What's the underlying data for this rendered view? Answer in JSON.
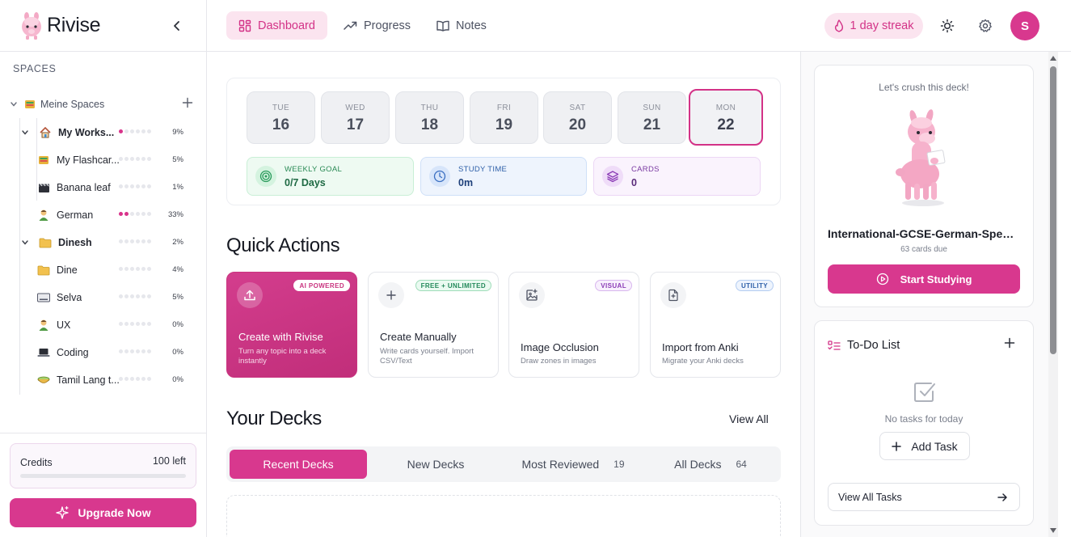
{
  "app": {
    "name": "Rivise"
  },
  "sidebar": {
    "spaces_title": "SPACES",
    "root": {
      "label": "Meine Spaces"
    },
    "items": [
      {
        "label": "My Works...",
        "bold": true,
        "level": 1,
        "expandable": true,
        "icon": "house-icon",
        "progress_dots": 1,
        "percent": "9%"
      },
      {
        "label": "My Flashcar...",
        "bold": false,
        "level": 2,
        "expandable": false,
        "icon": "card-box-icon",
        "progress_dots": 0,
        "percent": "5%"
      },
      {
        "label": "Banana leaf",
        "bold": false,
        "level": 2,
        "expandable": false,
        "icon": "clapper-icon",
        "progress_dots": 0,
        "percent": "1%"
      },
      {
        "label": "German",
        "bold": false,
        "level": 2,
        "expandable": false,
        "icon": "person-icon",
        "progress_dots": 2,
        "percent": "33%"
      },
      {
        "label": "Dinesh",
        "bold": true,
        "level": 1,
        "expandable": true,
        "icon": "folder-icon",
        "progress_dots": 0,
        "percent": "2%"
      },
      {
        "label": "Dine",
        "bold": false,
        "level": 1,
        "expandable": false,
        "icon": "folder-icon",
        "progress_dots": 0,
        "percent": "4%"
      },
      {
        "label": "Selva",
        "bold": false,
        "level": 1,
        "expandable": false,
        "icon": "keyboard-icon",
        "progress_dots": 0,
        "percent": "5%"
      },
      {
        "label": "UX",
        "bold": false,
        "level": 1,
        "expandable": false,
        "icon": "person-icon",
        "progress_dots": 0,
        "percent": "0%"
      },
      {
        "label": "Coding",
        "bold": false,
        "level": 1,
        "expandable": false,
        "icon": "laptop-icon",
        "progress_dots": 0,
        "percent": "0%"
      },
      {
        "label": "Tamil Lang t...",
        "bold": false,
        "level": 1,
        "expandable": false,
        "icon": "bowl-icon",
        "progress_dots": 0,
        "percent": "0%"
      }
    ],
    "credits": {
      "label": "Credits",
      "value": "100 left"
    },
    "upgrade_label": "Upgrade Now"
  },
  "topbar": {
    "tabs": [
      {
        "label": "Dashboard",
        "active": true,
        "icon": "grid-icon"
      },
      {
        "label": "Progress",
        "active": false,
        "icon": "trend-icon"
      },
      {
        "label": "Notes",
        "active": false,
        "icon": "book-icon"
      }
    ],
    "streak": "1 day streak",
    "avatar_initial": "S"
  },
  "week": {
    "days": [
      {
        "dow": "TUE",
        "num": "16",
        "today": false
      },
      {
        "dow": "WED",
        "num": "17",
        "today": false
      },
      {
        "dow": "THU",
        "num": "18",
        "today": false
      },
      {
        "dow": "FRI",
        "num": "19",
        "today": false
      },
      {
        "dow": "SAT",
        "num": "20",
        "today": false
      },
      {
        "dow": "SUN",
        "num": "21",
        "today": false
      },
      {
        "dow": "MON",
        "num": "22",
        "today": true
      }
    ],
    "stats": [
      {
        "key": "WEEKLY GOAL",
        "value": "0/7 Days",
        "icon": "target-icon",
        "color": "#1f7a4a"
      },
      {
        "key": "STUDY TIME",
        "value": "0m",
        "icon": "clock-icon",
        "color": "#1f4f8a"
      },
      {
        "key": "CARDS",
        "value": "0",
        "icon": "layers-icon",
        "color": "#6a2c8c"
      }
    ]
  },
  "quick_actions": {
    "title": "Quick Actions",
    "items": [
      {
        "title": "Create with Rivise",
        "desc": "Turn any topic into a deck instantly",
        "badge": "AI POWERED",
        "icon": "upload-icon"
      },
      {
        "title": "Create Manually",
        "desc": "Write cards yourself. Import CSV/Text",
        "badge": "FREE + UNLIMITED",
        "icon": "plus-icon"
      },
      {
        "title": "Image Occlusion",
        "desc": "Draw zones in images",
        "badge": "VISUAL",
        "icon": "image-plus-icon"
      },
      {
        "title": "Import from Anki",
        "desc": "Migrate your Anki decks",
        "badge": "UTILITY",
        "icon": "file-import-icon"
      }
    ]
  },
  "decks": {
    "title": "Your Decks",
    "view_all": "View All",
    "tabs": [
      {
        "label": "Recent Decks",
        "count": "",
        "active": true
      },
      {
        "label": "New Decks",
        "count": "",
        "active": false
      },
      {
        "label": "Most Reviewed",
        "count": "19",
        "active": false
      },
      {
        "label": "All Decks",
        "count": "64",
        "active": false
      }
    ]
  },
  "right": {
    "crush": "Let's crush this deck!",
    "deck_name": "International-GCSE-German-Specifi...",
    "due": "63 cards due",
    "start_label": "Start Studying",
    "todo_title": "To-Do List",
    "empty_text": "No tasks for today",
    "add_task": "Add Task",
    "view_all_tasks": "View All Tasks"
  },
  "colors": {
    "accent": "#d8388e",
    "accent_soft": "#fbe4ef"
  }
}
